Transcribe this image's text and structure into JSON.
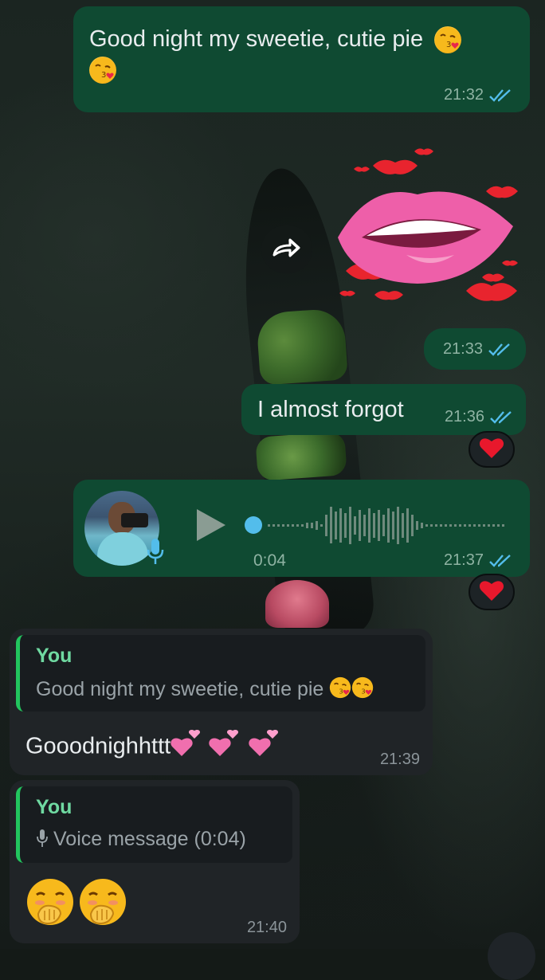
{
  "messages": {
    "m1": {
      "text": "Good night my sweetie, cutie pie",
      "time": "21:32"
    },
    "sticker": {
      "time": "21:33"
    },
    "m2": {
      "text": "I almost forgot",
      "time": "21:36",
      "reaction": "heart"
    },
    "voice": {
      "duration": "0:04",
      "time": "21:37",
      "reaction": "heart"
    },
    "reply1": {
      "quote_author": "You",
      "quote_text": "Good night my sweetie, cutie pie",
      "text": "Gooodnighhttt",
      "time": "21:39"
    },
    "reply2": {
      "quote_author": "You",
      "quote_text": "Voice message (0:04)",
      "time": "21:40"
    }
  },
  "colors": {
    "outgoing_bubble": "#0f4a32",
    "incoming_bubble": "#202427",
    "read_ticks": "#53bdeb",
    "quote_accent": "#22c55e"
  },
  "icons": [
    "double-check-icon",
    "forward-icon",
    "play-icon",
    "mic-icon",
    "heart-reaction-icon",
    "kiss-emoji",
    "hand-over-mouth-emoji",
    "two-hearts-emoji"
  ]
}
